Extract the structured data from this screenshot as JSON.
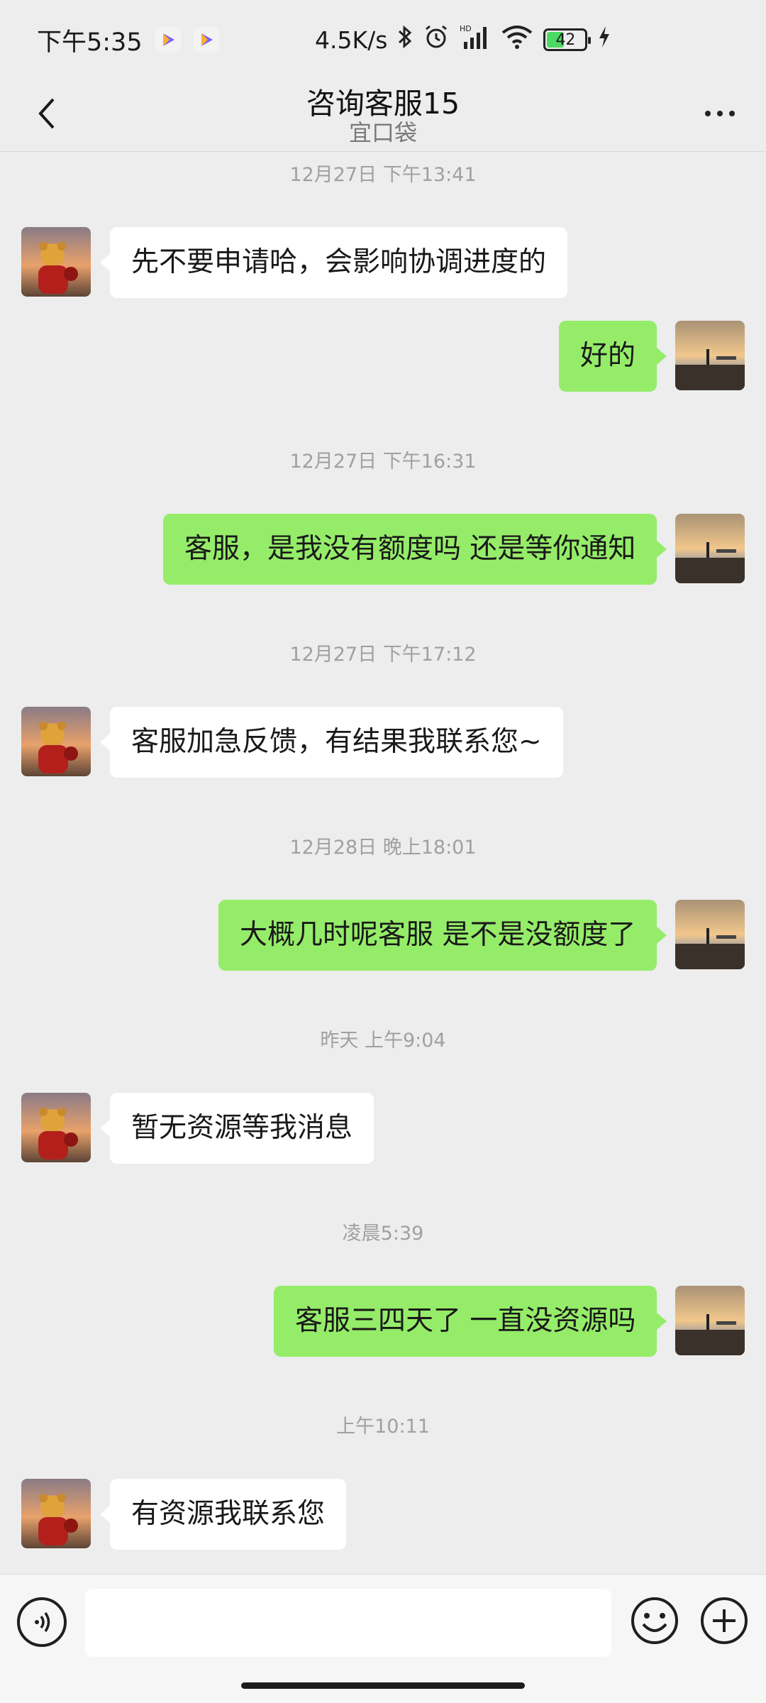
{
  "status_bar": {
    "time": "下午5:35",
    "network_speed": "4.5K/s",
    "signal_label": "HD",
    "battery_level": "42",
    "icons": [
      "video-app-icon",
      "video-app-icon",
      "bluetooth-icon",
      "alarm-icon",
      "signal-icon",
      "wifi-icon",
      "battery-icon",
      "charging-icon"
    ]
  },
  "header": {
    "title": "咨询客服15",
    "subtitle": "宜口袋"
  },
  "messages": [
    {
      "kind": "timestamp",
      "text": "12月27日 下午13:41"
    },
    {
      "kind": "incoming",
      "text": "先不要申请哈，会影响协调进度的"
    },
    {
      "kind": "outgoing",
      "text": "好的"
    },
    {
      "kind": "timestamp",
      "text": "12月27日 下午16:31"
    },
    {
      "kind": "outgoing",
      "text": "客服，是我没有额度吗 还是等你通知"
    },
    {
      "kind": "timestamp",
      "text": "12月27日 下午17:12"
    },
    {
      "kind": "incoming",
      "text": "客服加急反馈，有结果我联系您~"
    },
    {
      "kind": "timestamp",
      "text": "12月28日 晚上18:01"
    },
    {
      "kind": "outgoing",
      "text": "大概几时呢客服 是不是没额度了"
    },
    {
      "kind": "timestamp",
      "text": "昨天 上午9:04"
    },
    {
      "kind": "incoming",
      "text": "暂无资源等我消息"
    },
    {
      "kind": "timestamp",
      "text": "凌晨5:39"
    },
    {
      "kind": "outgoing",
      "text": "客服三四天了 一直没资源吗"
    },
    {
      "kind": "timestamp",
      "text": "上午10:11"
    },
    {
      "kind": "incoming",
      "text": "有资源我联系您"
    }
  ],
  "input": {
    "value": "",
    "placeholder": ""
  },
  "colors": {
    "background": "#ededed",
    "outgoing_bubble": "#95ec69",
    "incoming_bubble": "#ffffff",
    "timestamp_text": "#a0a0a0"
  }
}
